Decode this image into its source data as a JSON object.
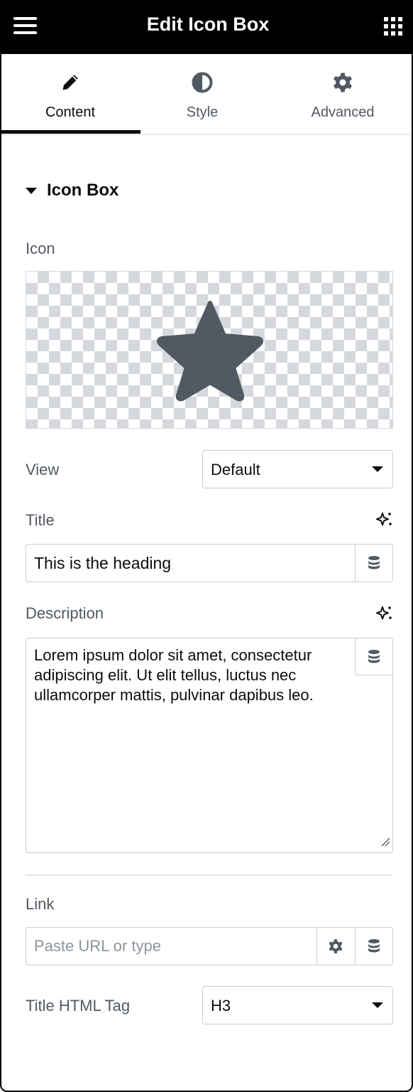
{
  "header": {
    "title": "Edit Icon Box",
    "menu_icon": "hamburger-menu-icon",
    "apps_icon": "grid-apps-icon"
  },
  "tabs": [
    {
      "label": "Content",
      "icon": "pencil-icon",
      "active": true
    },
    {
      "label": "Style",
      "icon": "half-circle-contrast-icon",
      "active": false
    },
    {
      "label": "Advanced",
      "icon": "gear-icon",
      "active": false
    }
  ],
  "section": {
    "title": "Icon Box",
    "expanded": true
  },
  "icon_field": {
    "label": "Icon",
    "selected_icon": "star-icon"
  },
  "view_field": {
    "label": "View",
    "value": "Default"
  },
  "title_field": {
    "label": "Title",
    "value": "This is the heading"
  },
  "description_field": {
    "label": "Description",
    "value": "Lorem ipsum dolor sit amet, consectetur adipiscing elit. Ut elit tellus, luctus nec ullamcorper mattis, pulvinar dapibus leo."
  },
  "link_field": {
    "label": "Link",
    "placeholder": "Paste URL or type",
    "value": ""
  },
  "title_tag_field": {
    "label": "Title HTML Tag",
    "value": "H3"
  },
  "colors": {
    "header_bg": "#000000",
    "text": "#515962",
    "text_strong": "#0c0d0e",
    "border": "#c9cdd2",
    "icon_fill": "#515962"
  }
}
